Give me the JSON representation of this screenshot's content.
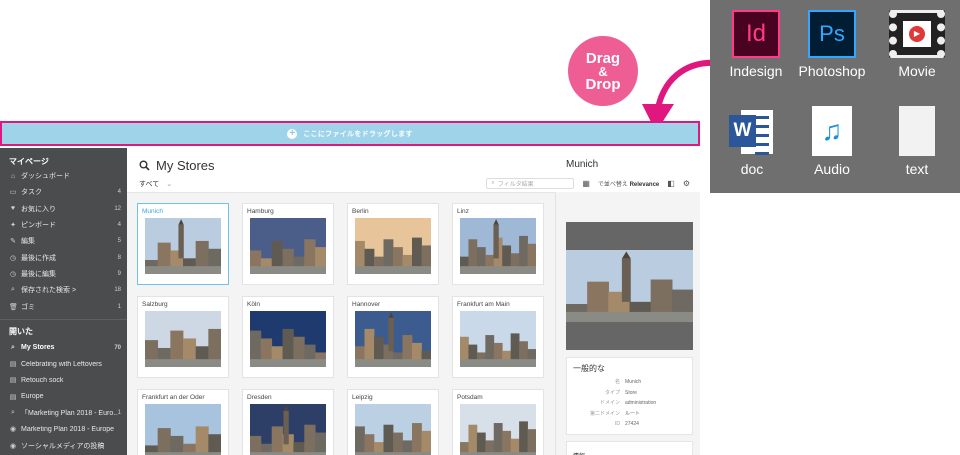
{
  "badge": {
    "line1": "Drag",
    "line2": "&",
    "line3": "Drop"
  },
  "dropbar": {
    "plus": "+",
    "text": "ここにファイルをドラッグします"
  },
  "filetypes": [
    {
      "label": "Indesign",
      "glyph": "Id"
    },
    {
      "label": "Photoshop",
      "glyph": "Ps"
    },
    {
      "label": "Movie",
      "glyph": "▶"
    },
    {
      "label": "doc",
      "glyph": "W"
    },
    {
      "label": "Audio",
      "glyph": "♫"
    },
    {
      "label": "text",
      "glyph": ""
    }
  ],
  "sidebar": {
    "mypage_header": "マイページ",
    "items": [
      {
        "icon": "⌂",
        "label": "ダッシュボード",
        "count": ""
      },
      {
        "icon": "▭",
        "label": "タスク",
        "count": "4"
      },
      {
        "icon": "♥",
        "label": "お気に入り",
        "count": "12"
      },
      {
        "icon": "✦",
        "label": "ピンボード",
        "count": "4"
      },
      {
        "icon": "✎",
        "label": "編集",
        "count": "5"
      },
      {
        "icon": "◷",
        "label": "最後に作成",
        "count": "8"
      },
      {
        "icon": "◷",
        "label": "最後に編集",
        "count": "9"
      },
      {
        "icon": "⌕",
        "label": "保存された検索 >",
        "count": "18"
      },
      {
        "icon": "🗑",
        "label": "ゴミ",
        "count": "1"
      }
    ],
    "open_header": "開いた",
    "open_items": [
      {
        "icon": "⌕",
        "label": "My Stores",
        "count": "70"
      },
      {
        "icon": "▤",
        "label": "Celebrating with Leftovers",
        "count": ""
      },
      {
        "icon": "▤",
        "label": "Retouch sock",
        "count": ""
      },
      {
        "icon": "▤",
        "label": "Europe",
        "count": ""
      },
      {
        "icon": "⌕",
        "label": "「Marketing Plan 2018 - Euro...」",
        "count": "1"
      },
      {
        "icon": "◉",
        "label": "Marketing Plan 2018 - Europe",
        "count": ""
      },
      {
        "icon": "◉",
        "label": "ソーシャルメディアの投稿",
        "count": ""
      }
    ]
  },
  "main": {
    "title": "My Stores",
    "filter": "すべて",
    "search_placeholder": "フィルタ結果",
    "sort_label": "で並べ替え",
    "sort_value": "Relevance",
    "cards": [
      "Munich",
      "Hamburg",
      "Berlin",
      "Linz",
      "Salzburg",
      "Köln",
      "Hannover",
      "Frankfurt am Main",
      "Frankfurt an der Oder",
      "Dresden",
      "Leipzig",
      "Potsdam"
    ]
  },
  "detail": {
    "title": "Munich",
    "section": "一般的な",
    "fields": [
      {
        "key": "名",
        "value": "Munich"
      },
      {
        "key": "タイプ",
        "value": "Store"
      },
      {
        "key": "ドメイン",
        "value": "administration"
      },
      {
        "key": "第二ドメイン",
        "value": "ルート"
      },
      {
        "key": "ID",
        "value": "27424"
      }
    ],
    "next_section": "情報"
  },
  "colors": {
    "accent": "#e0177f",
    "dropbar": "#9fd3ea",
    "sidebar": "#4b4c4d",
    "badge": "#ee5d93"
  }
}
